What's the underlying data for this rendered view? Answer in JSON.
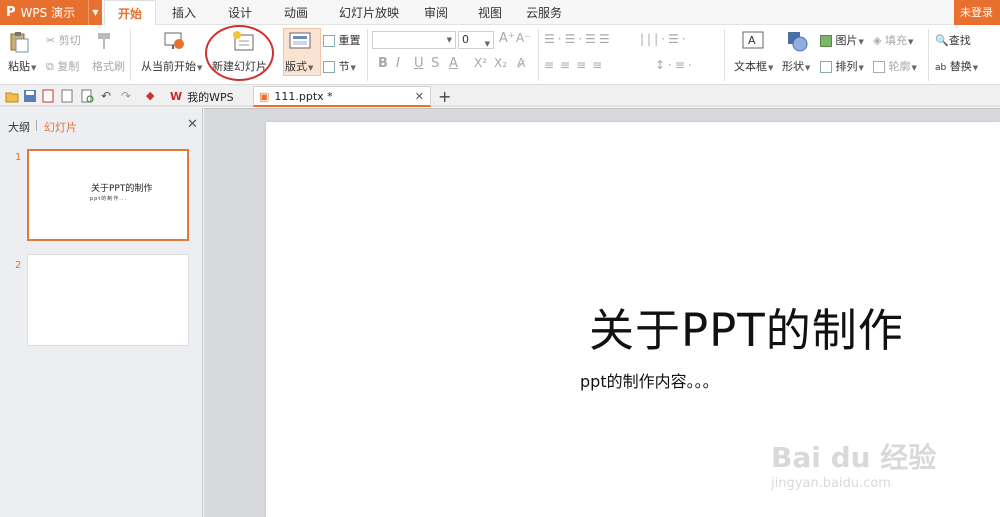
{
  "app": {
    "name": "WPS 演示",
    "login": "未登录"
  },
  "menu": {
    "tabs": [
      "开始",
      "插入",
      "设计",
      "动画",
      "幻灯片放映",
      "审阅",
      "视图",
      "云服务"
    ],
    "active": "开始"
  },
  "ribbon": {
    "paste": "粘贴",
    "cut": "剪切",
    "copy": "复制",
    "format_painter": "格式刷",
    "from_current": "从当前开始",
    "new_slide": "新建幻灯片",
    "layout": "版式",
    "reset": "重置",
    "section": "节",
    "font_size": "0",
    "text_box": "文本框",
    "shape": "形状",
    "picture": "图片",
    "arrange": "排列",
    "fill": "填充",
    "outline": "轮廓",
    "find": "查找",
    "replace": "替换"
  },
  "doc_tabs": [
    {
      "label": "我的WPS"
    },
    {
      "label": "111.pptx *"
    }
  ],
  "panel": {
    "outline_tab": "大纲",
    "slides_tab": "幻灯片"
  },
  "thumbnails": [
    {
      "number": "1",
      "title": "关于PPT的制作",
      "body": "ppt的制作..."
    },
    {
      "number": "2"
    }
  ],
  "slide": {
    "title": "关于PPT的制作",
    "body": "ppt的制作内容。。。"
  },
  "watermark": {
    "brand": "Bai du 经验",
    "url": "jingyan.baidu.com"
  },
  "colors": {
    "accent": "#e8702f",
    "annotation": "#d32f2f"
  }
}
